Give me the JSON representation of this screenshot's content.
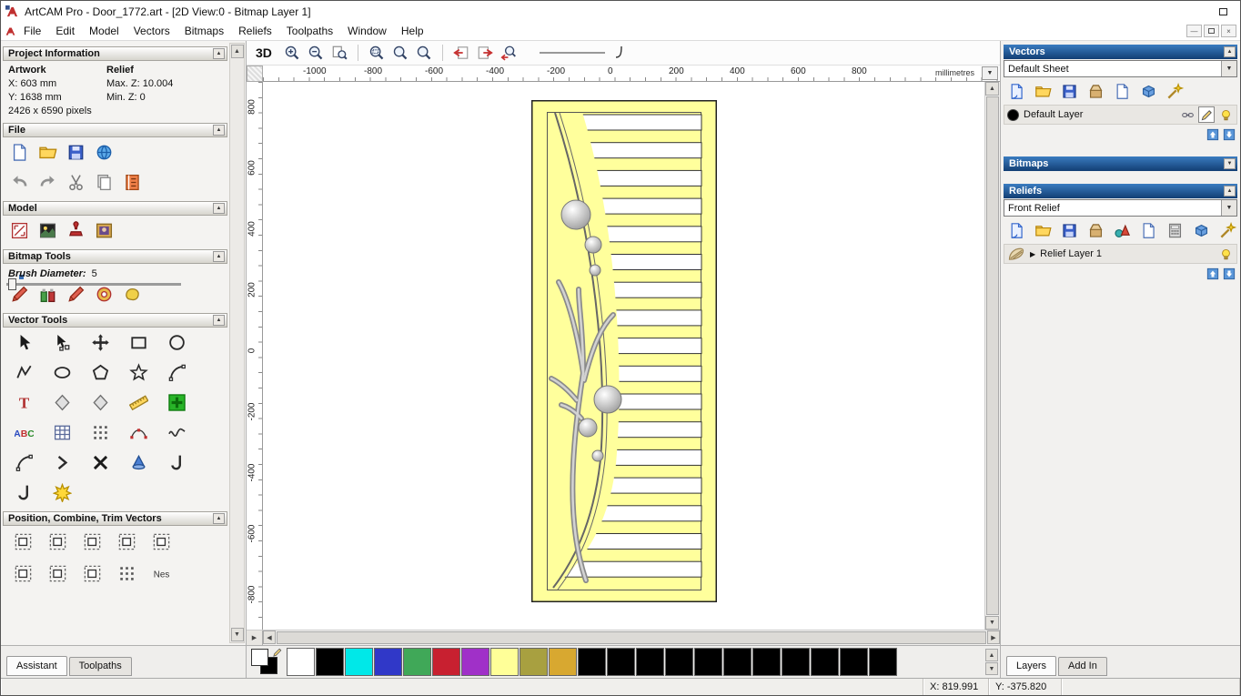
{
  "window": {
    "title": "ArtCAM Pro - Door_1772.art - [2D View:0 - Bitmap Layer 1]"
  },
  "menu": {
    "items": [
      "File",
      "Edit",
      "Model",
      "Vectors",
      "Bitmaps",
      "Reliefs",
      "Toolpaths",
      "Window",
      "Help"
    ]
  },
  "toolbar": {
    "view_3d": "3D",
    "zoom_group_a": [
      "zoom-in",
      "zoom-out",
      "zoom-page"
    ],
    "zoom_group_b": [
      "zoom-window",
      "zoom-fit",
      "zoom-scale"
    ],
    "zoom_group_c": [
      "previous-view",
      "next-view",
      "zoom-previous"
    ]
  },
  "assistant": {
    "sections": {
      "project_information": {
        "title": "Project Information",
        "artwork_header": "Artwork",
        "relief_header": "Relief",
        "artwork_x": "X: 603 mm",
        "artwork_y": "Y: 1638 mm",
        "relief_max": "Max. Z: 10.004",
        "relief_min": "Min. Z: 0",
        "pixels": "2426 x 6590 pixels"
      },
      "file_title": "File",
      "model_title": "Model",
      "bitmap_tools_title": "Bitmap Tools",
      "vector_tools_title": "Vector Tools",
      "position_title": "Position, Combine, Trim Vectors"
    },
    "brush": {
      "label": "Brush Diameter:",
      "value": "5"
    },
    "icon_rows": {
      "file_row1": [
        "new-model",
        "open-model",
        "save-model",
        "import-export"
      ],
      "file_row2": [
        "undo",
        "redo",
        "cut",
        "paste",
        "notes"
      ],
      "model_row": [
        "set-model-size",
        "lighting-material",
        "relief-stamp",
        "load-texture"
      ],
      "bitmap_row": [
        "draw",
        "paint-selective",
        "draw-fine",
        "colour-cycle",
        "flood-fill"
      ],
      "vector_grid": [
        "select-vectors",
        "node-editing",
        "transform-vectors",
        "create-rectangle",
        "create-circle",
        "create-polyline",
        "create-ellipse",
        "create-polygon",
        "create-star",
        "create-arc",
        "create-text",
        "wrap-text",
        "offset-vector",
        "measure",
        "block-copy",
        "text-block",
        "snap-grid",
        "paste-array",
        "fit-arcs",
        "fit-curve",
        "join-tangent",
        "close-vector",
        "trim-vectors",
        "interactive-trim",
        "fillet",
        "bezier-editing",
        "vector-wizard"
      ],
      "position_row1": [
        "align-left",
        "align-centre",
        "align-top",
        "align-bottom",
        "space-evenly"
      ],
      "position_row2": [
        "align-objects",
        "combine-vectors",
        "weld-vectors",
        "paste-along",
        "nesting"
      ]
    },
    "tabs": [
      {
        "label": "Assistant",
        "active": true
      },
      {
        "label": "Toolpaths",
        "active": false
      }
    ]
  },
  "canvas": {
    "h_ruler": {
      "ticks": [
        "-1000",
        "-800",
        "-600",
        "-400",
        "-200",
        "0",
        "200",
        "400",
        "600",
        "800"
      ],
      "unit": "millimetres"
    },
    "v_ruler": {
      "ticks": [
        "800",
        "600",
        "400",
        "200",
        "0",
        "-200",
        "-400",
        "-600",
        "-800"
      ]
    }
  },
  "door": {
    "fill": "#FFFF9C",
    "slat_fill": "#FFFFFF",
    "slat_count": 17,
    "outline": "#222222"
  },
  "right_panel": {
    "vectors": {
      "title": "Vectors",
      "sheet_selector": "Default Sheet",
      "layer_name": "Default Layer",
      "icons": [
        "new-vector-sheet",
        "open-vectors",
        "save-vectors",
        "merge-vectors",
        "new-vector-layer",
        "delete-vector-layer",
        "vector-wizard-panel"
      ]
    },
    "bitmaps": {
      "title": "Bitmaps"
    },
    "reliefs": {
      "title": "Reliefs",
      "selector": "Front Relief",
      "layer_name": "Relief Layer 1",
      "icons": [
        "new-relief",
        "open-relief",
        "save-relief",
        "merge-relief",
        "relief-primitives",
        "new-relief-layer",
        "relief-calculate",
        "relief-cube",
        "relief-wizard"
      ]
    },
    "tabs": [
      {
        "label": "Layers",
        "active": true
      },
      {
        "label": "Add In",
        "active": false
      }
    ]
  },
  "palette": {
    "colors": [
      "#FFFFFF",
      "#000000",
      "#00E8E8",
      "#3038C8",
      "#40A858",
      "#C82030",
      "#A030C8",
      "#FFFF98",
      "#A8A040",
      "#D8A830",
      "#000000",
      "#000000",
      "#000000",
      "#000000",
      "#000000",
      "#000000",
      "#000000",
      "#000000",
      "#000000",
      "#000000",
      "#000000"
    ]
  },
  "status_bar": {
    "x": "X: 819.991",
    "y": "Y: -375.820"
  }
}
